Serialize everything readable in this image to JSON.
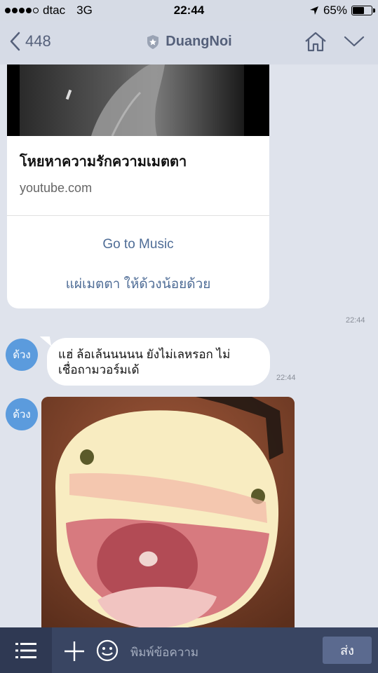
{
  "status": {
    "carrier": "dtac",
    "network": "3G",
    "time": "22:44",
    "battery_text": "65%",
    "battery_level": 0.65
  },
  "nav": {
    "back_count": "448",
    "title": "DuangNoi"
  },
  "link_card": {
    "title": "โหยหาความรักความเมตตา",
    "domain": "youtube.com",
    "action_primary": "Go to Music",
    "action_secondary": "แผ่เมตตา ให้ด้วงน้อยด้วย",
    "time": "22:44"
  },
  "messages": [
    {
      "avatar_text": "ด้วง",
      "line1": "แฮ่ ล้อเล้นนนนน ยังไม่เลหรอก ไม่",
      "line2": "เชื่อถามวอร์มเด้",
      "time": "22:44"
    },
    {
      "avatar_text": "ด้วง"
    }
  ],
  "composer": {
    "placeholder": "พิมพ์ข้อความ",
    "send_label": "ส่ง"
  },
  "icons": {
    "back": "chevron-left-icon",
    "shield": "shield-star-icon",
    "home": "home-icon",
    "dropdown": "chevron-down-icon",
    "menu": "menu-icon",
    "add": "plus-icon",
    "emoji": "smiley-icon",
    "location": "location-arrow-icon"
  }
}
